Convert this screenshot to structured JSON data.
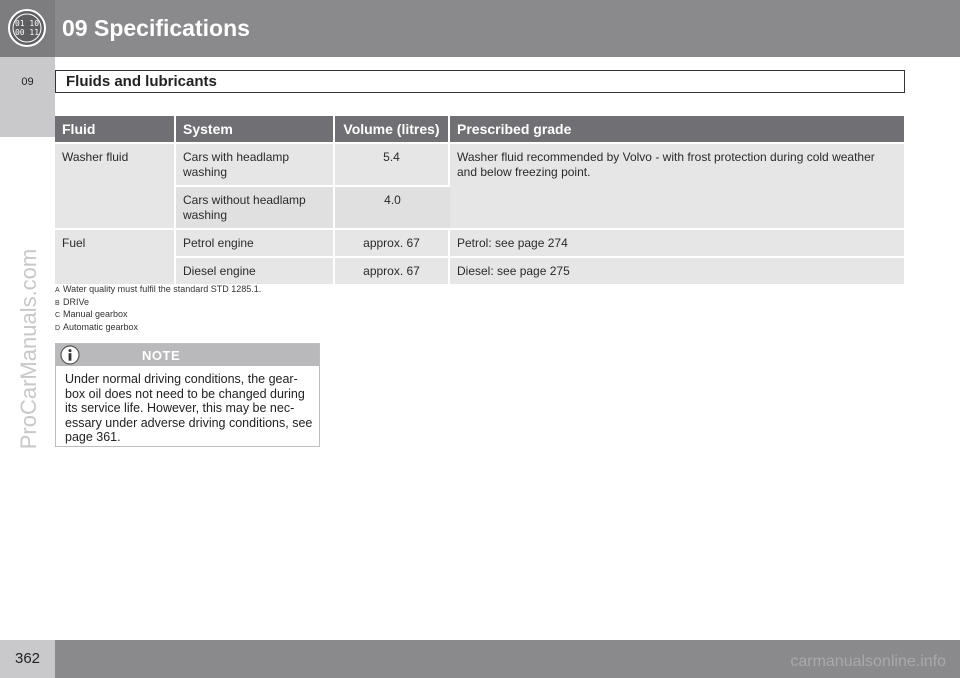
{
  "header": {
    "chapter_title": "09 Specifications",
    "gauge_top": "01 10",
    "gauge_bottom": "00 11"
  },
  "side_tab": {
    "label": "09"
  },
  "section": {
    "title": "Fluids and lubricants"
  },
  "table": {
    "headers": [
      "Fluid",
      "System",
      "Volume (litres)",
      "Prescribed grade"
    ],
    "washer": {
      "fluid": "Washer fluid",
      "row1": {
        "system": "Cars with headlamp washing",
        "volume": "5.4"
      },
      "row2": {
        "system": "Cars without headlamp washing",
        "volume": "4.0"
      },
      "grade": "Washer fluid recommended by Volvo - with frost protection during cold weather and below freezing point."
    },
    "fuel": {
      "fluid": "Fuel",
      "row1": {
        "system": "Petrol engine",
        "volume": "approx. 67",
        "grade": "Petrol: see page 274"
      },
      "row2": {
        "system": "Diesel engine",
        "volume": "approx. 67",
        "grade": "Diesel: see page 275"
      }
    }
  },
  "footnotes": [
    {
      "mark": "A",
      "text": "Water quality must fulfil the standard STD 1285.1."
    },
    {
      "mark": "B",
      "text": "DRIVe"
    },
    {
      "mark": "C",
      "text": "Manual gearbox"
    },
    {
      "mark": "D",
      "text": "Automatic gearbox"
    }
  ],
  "note": {
    "label": "NOTE",
    "icon": "info-icon",
    "text": "Under normal driving conditions, the gear-box oil does not need to be changed during its service life. However, this may be nec-essary under adverse driving conditions, see page 361."
  },
  "footer": {
    "page_number": "362",
    "watermark": "carmanualsonline.info"
  },
  "watermark_side": "ProCarManuals.com",
  "colors": {
    "header": "#8a8a8c",
    "table_header": "#707074",
    "table_cell": "#e6e6e7",
    "tab": "#c9c9cb"
  }
}
